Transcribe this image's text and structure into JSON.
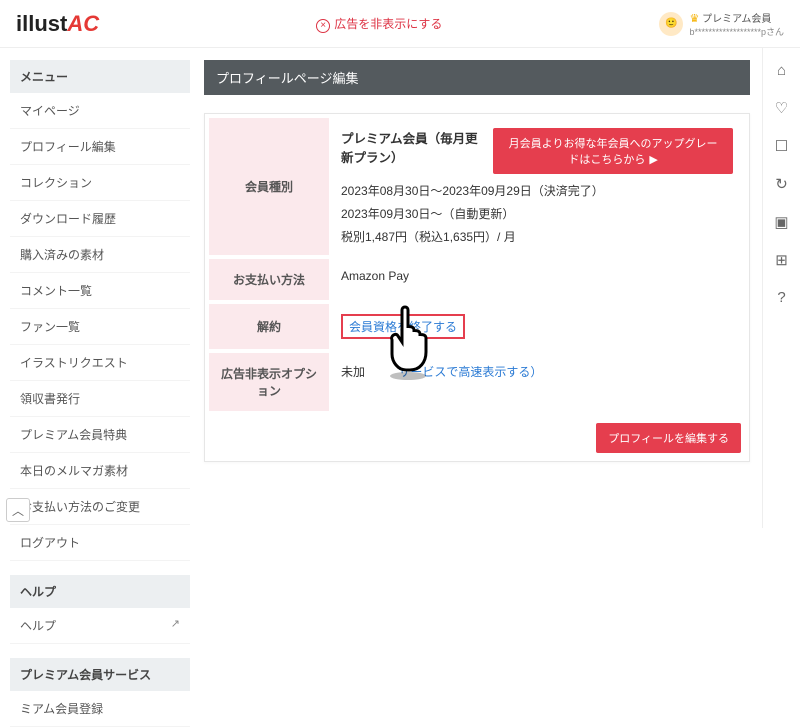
{
  "header": {
    "logo_text": "illust",
    "logo_ac": "AC",
    "hide_ad_label": "広告を非表示にする",
    "premium_label": "プレミアム会員",
    "user_masked": "b*******************pさん"
  },
  "sidebar": {
    "sections": [
      {
        "title": "メニュー",
        "items": [
          {
            "label": "マイページ"
          },
          {
            "label": "プロフィール編集"
          },
          {
            "label": "コレクション"
          },
          {
            "label": "ダウンロード履歴"
          },
          {
            "label": "購入済みの素材"
          },
          {
            "label": "コメント一覧"
          },
          {
            "label": "ファン一覧"
          },
          {
            "label": "イラストリクエスト"
          },
          {
            "label": "領収書発行"
          },
          {
            "label": "プレミアム会員特典"
          },
          {
            "label": "本日のメルマガ素材"
          },
          {
            "label": "お支払い方法のご変更"
          },
          {
            "label": "ログアウト"
          }
        ]
      },
      {
        "title": "ヘルプ",
        "items": [
          {
            "label": "ヘルプ",
            "external": true
          }
        ]
      },
      {
        "title": "プレミアム会員サービス",
        "items": [
          {
            "label": "ミアム会員登録"
          }
        ]
      }
    ]
  },
  "page": {
    "title": "プロフィールページ編集",
    "rows": {
      "member_type": {
        "th": "会員種別",
        "plan_name": "プレミアム会員（毎月更新プラン）",
        "upgrade_btn": "月会員よりお得な年会員へのアップグレードはこちらから",
        "period": "2023年08月30日～2023年09月29日（決済完了）",
        "renew": "2023年09月30日～（自動更新）",
        "price": "税別1,487円（税込1,635円）/ 月"
      },
      "pay_method": {
        "th": "お支払い方法",
        "value": "Amazon Pay"
      },
      "cancel": {
        "th": "解約",
        "link": "会員資格を終了する"
      },
      "ads": {
        "th": "広告非表示オプション",
        "status_prefix": "未加",
        "link_text": "サービスで高速表示する）"
      }
    },
    "edit_btn": "プロフィールを編集する"
  },
  "rightbar": {
    "icons": [
      "home",
      "heart",
      "bookmark",
      "history",
      "folder",
      "folder-plus",
      "help"
    ]
  }
}
